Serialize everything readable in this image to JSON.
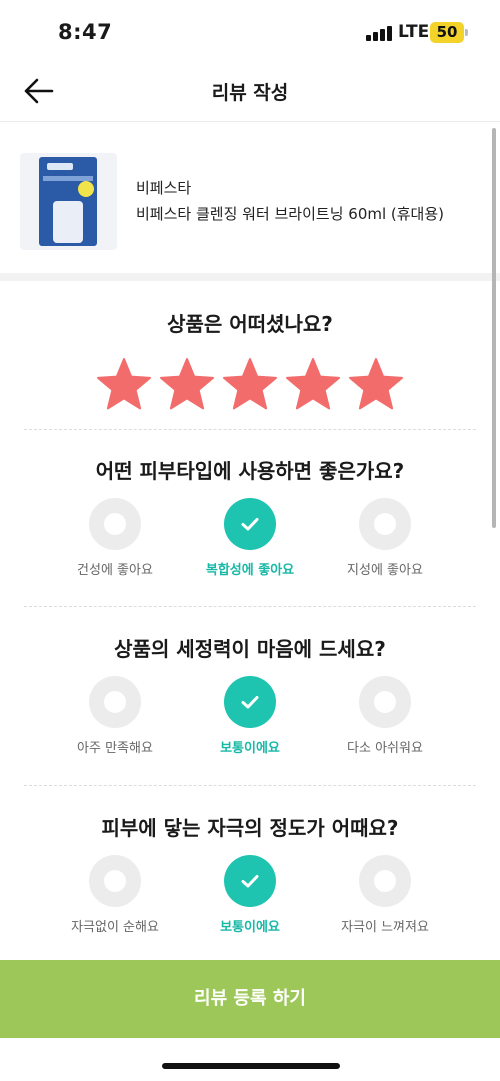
{
  "status_bar": {
    "time": "8:47",
    "network": "LTE",
    "battery": "50"
  },
  "header": {
    "title": "리뷰 작성"
  },
  "product": {
    "brand": "비페스타",
    "name": "비페스타 클렌징 워터 브라이트닝 60ml (휴대용)"
  },
  "rating": {
    "question": "상품은 어떠셨나요?",
    "stars": 5,
    "max_stars": 5,
    "star_color": "#f26c6c"
  },
  "questions": [
    {
      "question": "어떤 피부타입에 사용하면 좋은가요?",
      "options": [
        "건성에 좋아요",
        "복합성에 좋아요",
        "지성에 좋아요"
      ],
      "selected_index": 1
    },
    {
      "question": "상품의 세정력이 마음에 드세요?",
      "options": [
        "아주 만족해요",
        "보통이에요",
        "다소 아쉬워요"
      ],
      "selected_index": 1
    },
    {
      "question": "피부에 닿는 자극의 정도가 어때요?",
      "options": [
        "자극없이 순해요",
        "보통이에요",
        "자극이 느껴져요"
      ],
      "selected_index": 1
    }
  ],
  "submit": {
    "label": "리뷰 등록 하기",
    "color": "#9dc758"
  },
  "colors": {
    "accent": "#1ec4b0",
    "accent_text": "#17b8a6"
  },
  "icons": {
    "back": "arrow-left-icon",
    "star": "star-icon",
    "check": "check-icon"
  }
}
